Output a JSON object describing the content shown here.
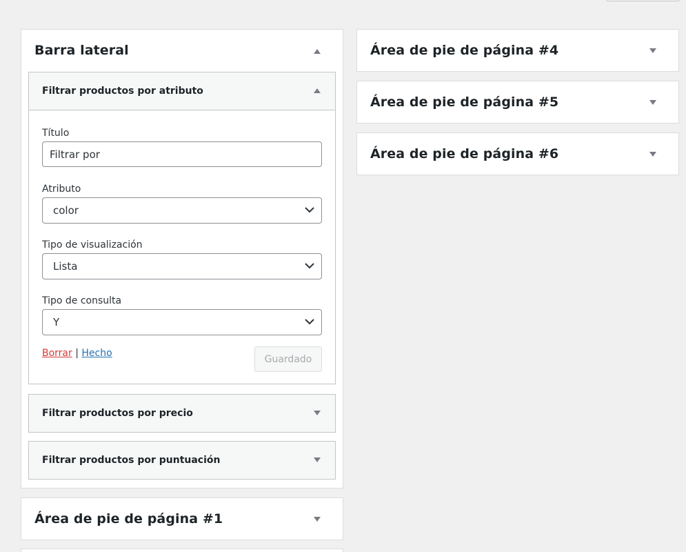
{
  "sidebar_area": {
    "title": "Barra lateral",
    "widgets": [
      {
        "title": "Filtrar productos por atributo",
        "expanded": true,
        "fields": {
          "title_label": "Título",
          "title_value": "Filtrar por",
          "attribute_label": "Atributo",
          "attribute_value": "color",
          "display_type_label": "Tipo de visualización",
          "display_type_value": "Lista",
          "query_type_label": "Tipo de consulta",
          "query_type_value": "Y"
        },
        "actions": {
          "delete_label": "Borrar",
          "separator": "|",
          "done_label": "Hecho",
          "saved_label": "Guardado"
        }
      },
      {
        "title": "Filtrar productos por precio",
        "expanded": false
      },
      {
        "title": "Filtrar productos por puntuación",
        "expanded": false
      }
    ]
  },
  "footer_areas": [
    {
      "title": "Área de pie de página #1"
    },
    {
      "title": "Área de pie de página #4"
    },
    {
      "title": "Área de pie de página #5"
    },
    {
      "title": "Área de pie de página #6"
    }
  ],
  "colors": {
    "background": "#f0f0f1",
    "delete_link": "#d63638",
    "done_link": "#2271b1",
    "arrow": "#787c82"
  }
}
